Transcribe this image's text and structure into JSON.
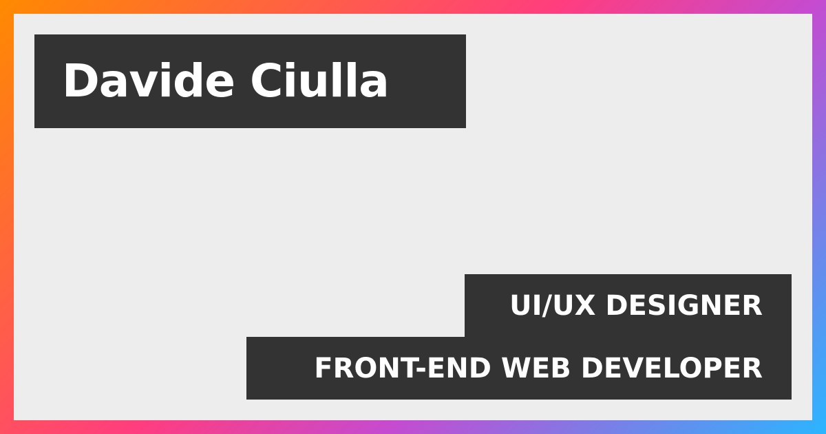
{
  "card": {
    "name": "Davide Ciulla",
    "roles": [
      "UI/UX DESIGNER",
      "FRONT-END WEB DEVELOPER"
    ]
  },
  "colors": {
    "background": "#ededed",
    "box": "#333333",
    "text": "#ffffff",
    "gradient_start": "#ff8a00",
    "gradient_mid": "#ff3d7f",
    "gradient_end": "#2bb5ff"
  }
}
